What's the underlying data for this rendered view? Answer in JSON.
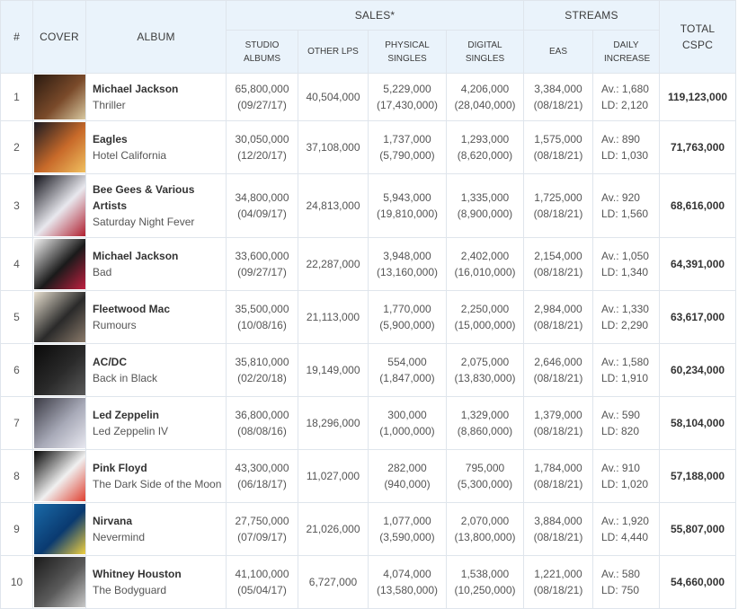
{
  "headers": {
    "num": "#",
    "cover": "COVER",
    "album": "ALBUM",
    "sales": "SALES*",
    "streams": "STREAMS",
    "total": "TOTAL CSPC",
    "studio_albums": "STUDIO ALBUMS",
    "other_lps": "OTHER LPS",
    "physical_singles": "PHYSICAL SINGLES",
    "digital_singles": "DIGITAL SINGLES",
    "eas": "EAS",
    "daily_increase": "DAILY INCREASE"
  },
  "rows": [
    {
      "rank": "1",
      "artist": "Michael Jackson",
      "album": "Thriller",
      "studio": "65,800,000",
      "studio_date": "(09/27/17)",
      "other_lps": "40,504,000",
      "phys": "5,229,000",
      "phys_sub": "(17,430,000)",
      "dig": "4,206,000",
      "dig_sub": "(28,040,000)",
      "eas": "3,384,000",
      "eas_date": "(08/18/21)",
      "av": "Av.: 1,680",
      "ld": "LD: 2,120",
      "total": "119,123,000",
      "cover_colors": [
        "#2a1a10",
        "#7a4a2a",
        "#d8c8a0"
      ]
    },
    {
      "rank": "2",
      "artist": "Eagles",
      "album": "Hotel California",
      "studio": "30,050,000",
      "studio_date": "(12/20/17)",
      "other_lps": "37,108,000",
      "phys": "1,737,000",
      "phys_sub": "(5,790,000)",
      "dig": "1,293,000",
      "dig_sub": "(8,620,000)",
      "eas": "1,575,000",
      "eas_date": "(08/18/21)",
      "av": "Av.: 890",
      "ld": "LD: 1,030",
      "total": "71,763,000",
      "cover_colors": [
        "#1a1a22",
        "#c86a2a",
        "#f0c060"
      ]
    },
    {
      "rank": "3",
      "artist": "Bee Gees & Various Artists",
      "album": "Saturday Night Fever",
      "studio": "34,800,000",
      "studio_date": "(04/09/17)",
      "other_lps": "24,813,000",
      "phys": "5,943,000",
      "phys_sub": "(19,810,000)",
      "dig": "1,335,000",
      "dig_sub": "(8,900,000)",
      "eas": "1,725,000",
      "eas_date": "(08/18/21)",
      "av": "Av.: 920",
      "ld": "LD: 1,560",
      "total": "68,616,000",
      "cover_colors": [
        "#101018",
        "#e8e8ee",
        "#b02030"
      ]
    },
    {
      "rank": "4",
      "artist": "Michael Jackson",
      "album": "Bad",
      "studio": "33,600,000",
      "studio_date": "(09/27/17)",
      "other_lps": "22,287,000",
      "phys": "3,948,000",
      "phys_sub": "(13,160,000)",
      "dig": "2,402,000",
      "dig_sub": "(16,010,000)",
      "eas": "2,154,000",
      "eas_date": "(08/18/21)",
      "av": "Av.: 1,050",
      "ld": "LD: 1,340",
      "total": "64,391,000",
      "cover_colors": [
        "#f2f2f2",
        "#1a1a1a",
        "#c02040"
      ]
    },
    {
      "rank": "5",
      "artist": "Fleetwood Mac",
      "album": "Rumours",
      "studio": "35,500,000",
      "studio_date": "(10/08/16)",
      "other_lps": "21,113,000",
      "phys": "1,770,000",
      "phys_sub": "(5,900,000)",
      "dig": "2,250,000",
      "dig_sub": "(15,000,000)",
      "eas": "2,984,000",
      "eas_date": "(08/18/21)",
      "av": "Av.: 1,330",
      "ld": "LD: 2,290",
      "total": "63,617,000",
      "cover_colors": [
        "#e8e0d0",
        "#2a2a2a",
        "#8a7a6a"
      ]
    },
    {
      "rank": "6",
      "artist": "AC/DC",
      "album": "Back in Black",
      "studio": "35,810,000",
      "studio_date": "(02/20/18)",
      "other_lps": "19,149,000",
      "phys": "554,000",
      "phys_sub": "(1,847,000)",
      "dig": "2,075,000",
      "dig_sub": "(13,830,000)",
      "eas": "2,646,000",
      "eas_date": "(08/18/21)",
      "av": "Av.: 1,580",
      "ld": "LD: 1,910",
      "total": "60,234,000",
      "cover_colors": [
        "#0a0a0a",
        "#2a2a2a",
        "#5a5a5a"
      ]
    },
    {
      "rank": "7",
      "artist": "Led Zeppelin",
      "album": "Led Zeppelin IV",
      "studio": "36,800,000",
      "studio_date": "(08/08/16)",
      "other_lps": "18,296,000",
      "phys": "300,000",
      "phys_sub": "(1,000,000)",
      "dig": "1,329,000",
      "dig_sub": "(8,860,000)",
      "eas": "1,379,000",
      "eas_date": "(08/18/21)",
      "av": "Av.: 590",
      "ld": "LD: 820",
      "total": "58,104,000",
      "cover_colors": [
        "#3a3a44",
        "#a8aab8",
        "#e8e8f0"
      ]
    },
    {
      "rank": "8",
      "artist": "Pink Floyd",
      "album": "The Dark Side of the Moon",
      "studio": "43,300,000",
      "studio_date": "(06/18/17)",
      "other_lps": "11,027,000",
      "phys": "282,000",
      "phys_sub": "(940,000)",
      "dig": "795,000",
      "dig_sub": "(5,300,000)",
      "eas": "1,784,000",
      "eas_date": "(08/18/21)",
      "av": "Av.: 910",
      "ld": "LD: 1,020",
      "total": "57,188,000",
      "cover_colors": [
        "#050505",
        "#f0f0f0",
        "#e04030"
      ]
    },
    {
      "rank": "9",
      "artist": "Nirvana",
      "album": "Nevermind",
      "studio": "27,750,000",
      "studio_date": "(07/09/17)",
      "other_lps": "21,026,000",
      "phys": "1,077,000",
      "phys_sub": "(3,590,000)",
      "dig": "2,070,000",
      "dig_sub": "(13,800,000)",
      "eas": "3,884,000",
      "eas_date": "(08/18/21)",
      "av": "Av.: 1,920",
      "ld": "LD: 4,440",
      "total": "55,807,000",
      "cover_colors": [
        "#1a6aa8",
        "#0a3a70",
        "#f0d040"
      ]
    },
    {
      "rank": "10",
      "artist": "Whitney Houston",
      "album": "The Bodyguard",
      "studio": "41,100,000",
      "studio_date": "(05/04/17)",
      "other_lps": "6,727,000",
      "phys": "4,074,000",
      "phys_sub": "(13,580,000)",
      "dig": "1,538,000",
      "dig_sub": "(10,250,000)",
      "eas": "1,221,000",
      "eas_date": "(08/18/21)",
      "av": "Av.: 580",
      "ld": "LD: 750",
      "total": "54,660,000",
      "cover_colors": [
        "#1a1a1a",
        "#5a5a5a",
        "#c8c8c8"
      ]
    }
  ]
}
